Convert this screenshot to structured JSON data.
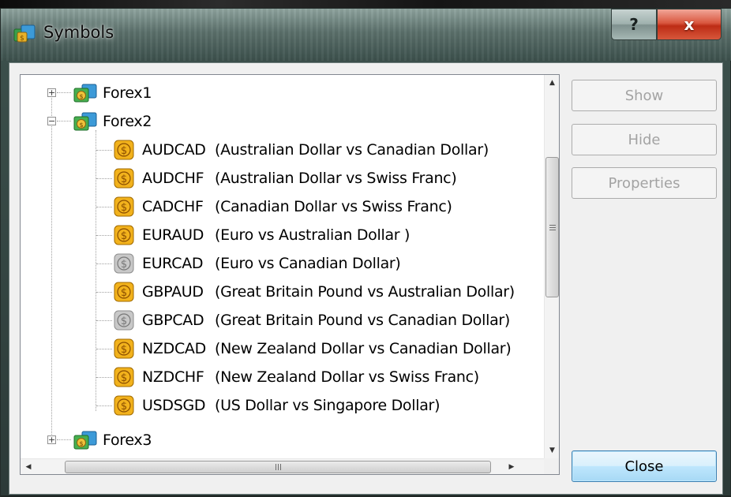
{
  "window": {
    "title": "Symbols",
    "help_label": "?",
    "close_label": "x"
  },
  "tree": {
    "groups": [
      {
        "label": "Forex1",
        "expanded": false
      },
      {
        "label": "Forex2",
        "expanded": true
      },
      {
        "label": "Forex3",
        "expanded": false
      }
    ],
    "items": [
      {
        "symbol": "AUDCAD",
        "desc": "(Australian Dollar vs Canadian Dollar)",
        "enabled": true
      },
      {
        "symbol": "AUDCHF",
        "desc": "(Australian Dollar vs Swiss Franc)",
        "enabled": true
      },
      {
        "symbol": "CADCHF",
        "desc": "(Canadian Dollar vs Swiss Franc)",
        "enabled": true
      },
      {
        "symbol": "EURAUD",
        "desc": "(Euro vs Australian Dollar )",
        "enabled": true
      },
      {
        "symbol": "EURCAD",
        "desc": "(Euro vs Canadian Dollar)",
        "enabled": false
      },
      {
        "symbol": "GBPAUD",
        "desc": "(Great Britain Pound vs Australian Dollar)",
        "enabled": true
      },
      {
        "symbol": "GBPCAD",
        "desc": "(Great Britain Pound vs Canadian Dollar)",
        "enabled": false
      },
      {
        "symbol": "NZDCAD",
        "desc": "(New Zealand Dollar vs Canadian Dollar)",
        "enabled": true
      },
      {
        "symbol": "NZDCHF",
        "desc": "(New Zealand Dollar vs Swiss Franc)",
        "enabled": true
      },
      {
        "symbol": "USDSGD",
        "desc": "(US Dollar vs Singapore Dollar)",
        "enabled": true
      }
    ]
  },
  "buttons": {
    "show": "Show",
    "hide": "Hide",
    "properties": "Properties",
    "close": "Close"
  },
  "colors": {
    "coin_enabled": "#f2b21c",
    "coin_disabled": "#c8c8c8",
    "close_button_border": "#3c7fb1"
  }
}
